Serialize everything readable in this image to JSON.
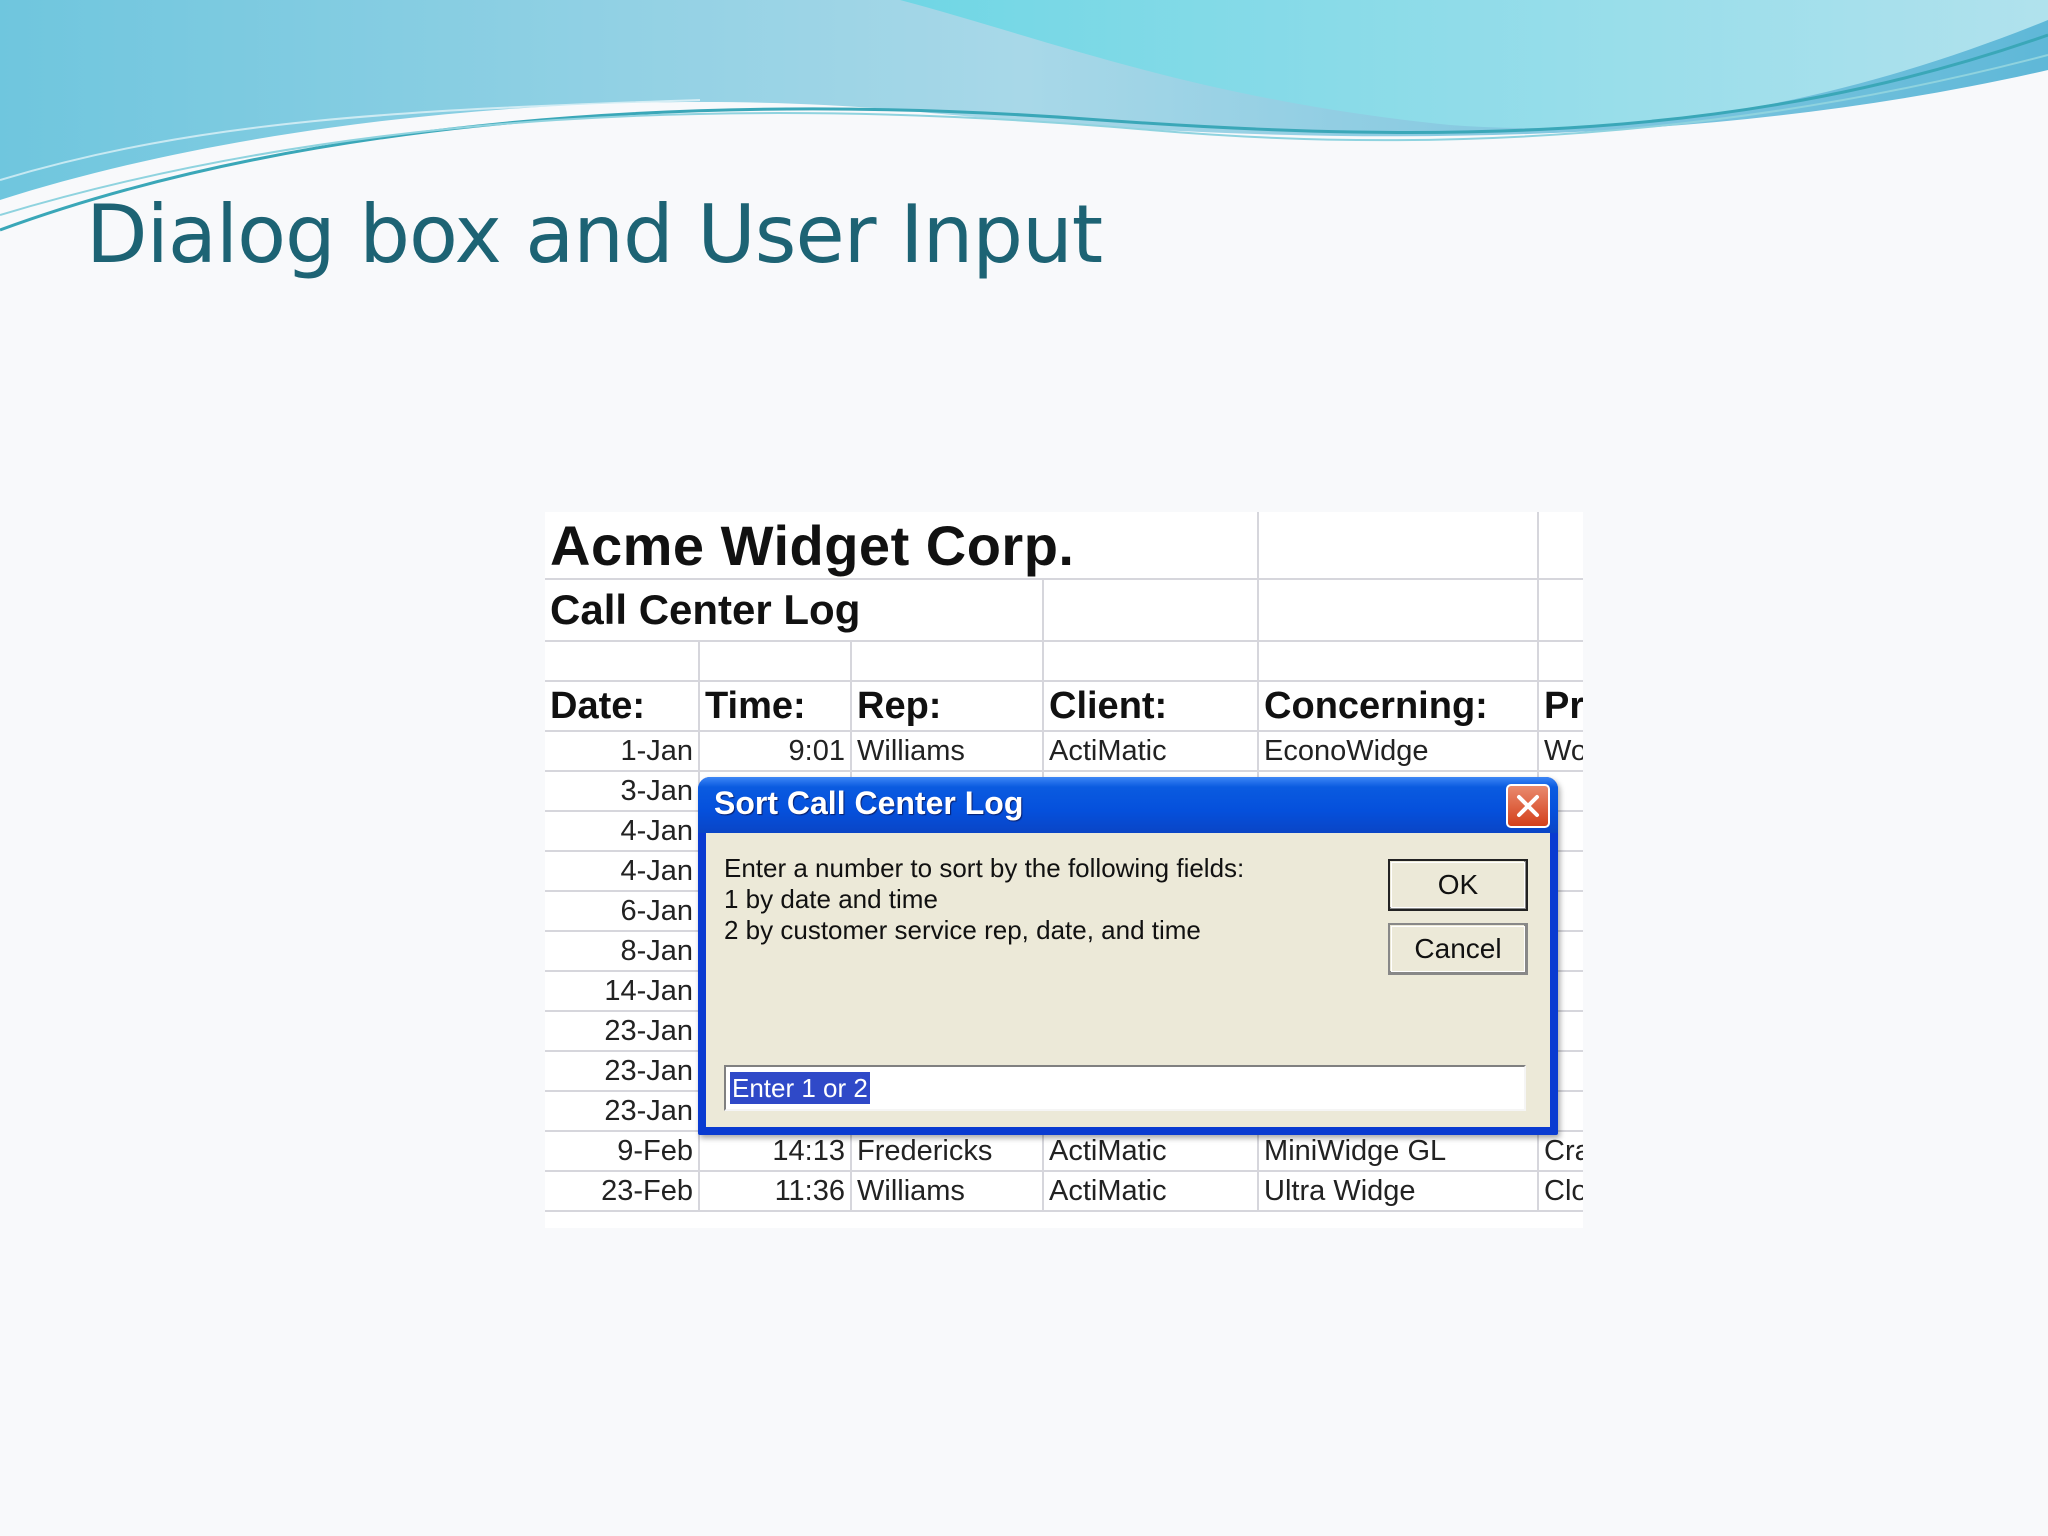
{
  "slide": {
    "title": "Dialog box and User Input"
  },
  "sheet": {
    "company": "Acme Widget Corp.",
    "subtitle": "Call Center Log",
    "headers": [
      "Date:",
      "Time:",
      "Rep:",
      "Client:",
      "Concerning:",
      "Pr"
    ],
    "rows": [
      [
        "1-Jan",
        "9:01",
        "Williams",
        "ActiMatic",
        "EconoWidge",
        "Wo"
      ],
      [
        "3-Jan",
        "",
        "",
        "",
        "",
        ""
      ],
      [
        "4-Jan",
        "",
        "",
        "",
        "",
        ""
      ],
      [
        "4-Jan",
        "",
        "",
        "",
        "",
        ""
      ],
      [
        "6-Jan",
        "",
        "",
        "",
        "",
        ""
      ],
      [
        "8-Jan",
        "",
        "",
        "",
        "",
        ""
      ],
      [
        "14-Jan",
        "",
        "",
        "",
        "",
        ""
      ],
      [
        "23-Jan",
        "",
        "",
        "",
        "",
        ""
      ],
      [
        "23-Jan",
        "",
        "",
        "",
        "",
        ""
      ],
      [
        "23-Jan",
        "",
        "",
        "",
        "",
        ""
      ],
      [
        "9-Feb",
        "14:13",
        "Fredericks",
        "ActiMatic",
        "MiniWidge GL",
        "Cra"
      ],
      [
        "23-Feb",
        "11:36",
        "Williams",
        "ActiMatic",
        "Ultra Widge",
        "Clo"
      ]
    ]
  },
  "dialog": {
    "title": "Sort Call Center Log",
    "prompt_lines": [
      "Enter a number to sort by the following fields:",
      "1 by date and time",
      "2 by customer service rep, date, and time"
    ],
    "ok_label": "OK",
    "cancel_label": "Cancel",
    "input_value": "Enter 1 or 2",
    "close_icon": "close-x-icon"
  },
  "colors": {
    "title_text": "#1d6374",
    "dialog_titlebar": "#0550dc",
    "dialog_body": "#ece9d8",
    "close_button": "#d4401b",
    "input_selection": "#2f49c8"
  }
}
